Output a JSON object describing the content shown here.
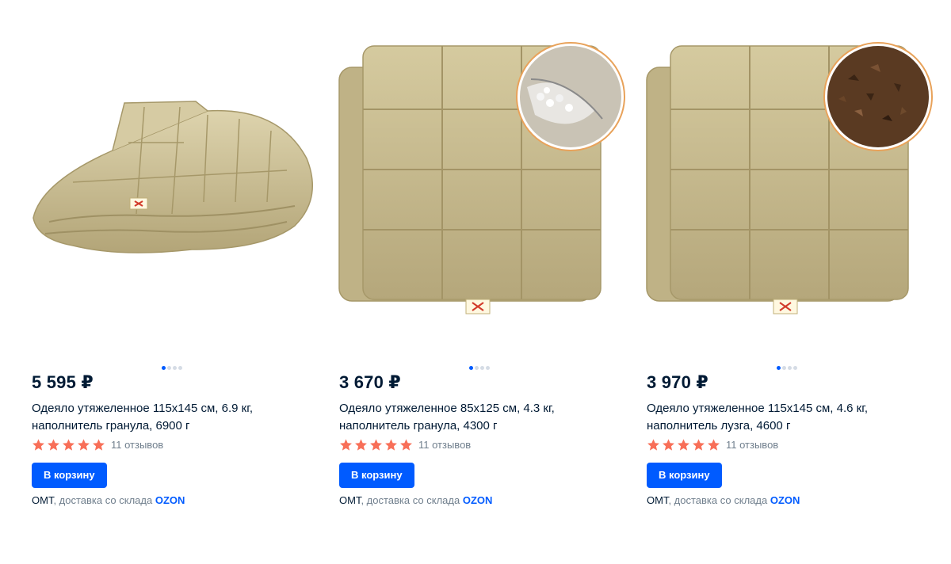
{
  "products": [
    {
      "price": "5 595 ₽",
      "title": "Одеяло утяжеленное 115х145 см, 6.9 кг, наполнитель гранула, 6900 г",
      "reviews": "11 отзывов",
      "rating": 5,
      "add_to_cart_label": "В корзину",
      "seller": "ОМТ",
      "delivery_text": ", доставка со склада ",
      "delivery_brand": "OZON",
      "image_count": 4,
      "active_image": 1
    },
    {
      "price": "3 670 ₽",
      "title": "Одеяло утяжеленное 85х125 см, 4.3 кг, наполнитель гранула, 4300 г",
      "reviews": "11 отзывов",
      "rating": 5,
      "add_to_cart_label": "В корзину",
      "seller": "ОМТ",
      "delivery_text": ", доставка со склада ",
      "delivery_brand": "OZON",
      "image_count": 4,
      "active_image": 1
    },
    {
      "price": "3 970 ₽",
      "title": "Одеяло утяжеленное 115х145 см, 4.6 кг, наполнитель лузга, 4600 г",
      "reviews": "11 отзывов",
      "rating": 5,
      "add_to_cart_label": "В корзину",
      "seller": "ОМТ",
      "delivery_text": ", доставка со склада ",
      "delivery_brand": "OZON",
      "image_count": 4,
      "active_image": 1
    }
  ],
  "colors": {
    "accent": "#005bff",
    "star": "#f86f58",
    "text": "#001a34",
    "muted": "#707f8d",
    "fabric": "#cbbf95"
  }
}
